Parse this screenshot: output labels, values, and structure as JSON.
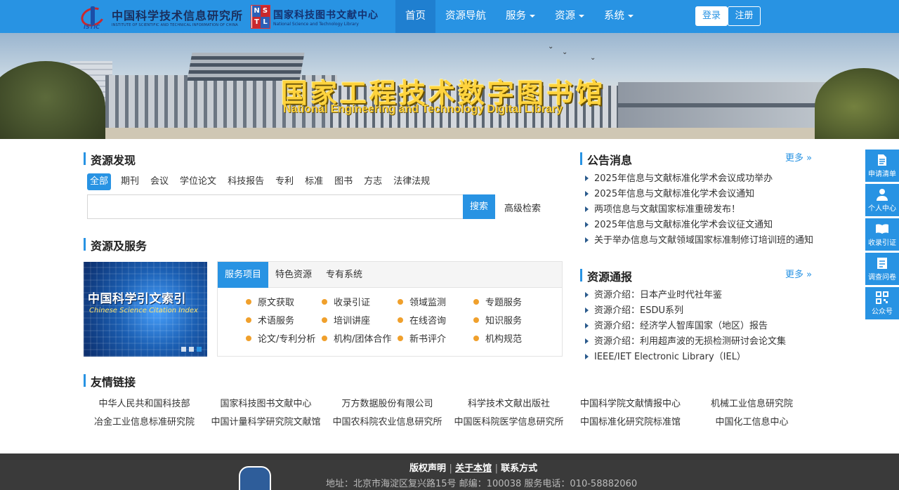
{
  "header": {
    "logo1": {
      "cn": "中国科学技术信息研究所",
      "en": "INSTITUTE OF SCIENTIFIC AND TECHNICAL INFORMATION OF CHINA",
      "mark": "ISTIC"
    },
    "logo2": {
      "cn": "国家科技图书文献中心",
      "en": "National Science and Technology Library",
      "mark": [
        "N",
        "S",
        "T",
        "L"
      ]
    },
    "menu": [
      "首页",
      "资源导航",
      "服务",
      "资源",
      "系统"
    ],
    "login": "登录",
    "register": "注册"
  },
  "banner": {
    "title": "国家工程技术数字图书馆",
    "subtitle": "National Engineering and Technology Digital Library"
  },
  "discovery": {
    "title": "资源发现",
    "tabs": [
      "全部",
      "期刊",
      "会议",
      "学位论文",
      "科技报告",
      "专利",
      "标准",
      "图书",
      "方志",
      "法律法规"
    ],
    "search_button": "搜索",
    "advanced": "高级检索",
    "search_value": ""
  },
  "services": {
    "title": "资源及服务",
    "carousel": {
      "cn": "中国科学引文索引",
      "en": "Chinese Science Citation Index"
    },
    "tabs": [
      "服务项目",
      "特色资源",
      "专有系统"
    ],
    "items": [
      "原文获取",
      "收录引证",
      "领域监测",
      "专题服务",
      "术语服务",
      "培训讲座",
      "在线咨询",
      "知识服务",
      "论文/专利分析",
      "机构/团体合作",
      "新书评介",
      "机构规范"
    ]
  },
  "friends": {
    "title": "友情链接",
    "items": [
      "中华人民共和国科技部",
      "国家科技图书文献中心",
      "万方数据股份有限公司",
      "科学技术文献出版社",
      "中国科学院文献情报中心",
      "机械工业信息研究院",
      "冶金工业信息标准研究院",
      "中国计量科学研究院文献馆",
      "中国农科院农业信息研究所",
      "中国医科院医学信息研究所",
      "中国标准化研究院标准馆",
      "中国化工信息中心"
    ]
  },
  "notices": {
    "title": "公告消息",
    "more": "更多 »",
    "items": [
      "2025年信息与文献标准化学术会议成功举办",
      "2025年信息与文献标准化学术会议通知",
      "两项信息与文献国家标准重磅发布！",
      "2025年信息与文献标准化学术会议征文通知",
      "关于举办信息与文献领域国家标准制修订培训班的通知"
    ]
  },
  "resources_news": {
    "title": "资源通报",
    "more": "更多 »",
    "items": [
      "资源介绍：日本产业时代社年鉴",
      "资源介绍：ESDU系列",
      "资源介绍：经济学人智库国家（地区）报告",
      "资源介绍：利用超声波的无损检测研讨会论文集",
      "IEEE/IET Electronic Library（IEL）"
    ]
  },
  "sidebar": [
    "申请清单",
    "个人中心",
    "收录引证",
    "调查问卷",
    "公众号"
  ],
  "footer": {
    "copyright": "版权声明",
    "about": "关于本馆",
    "contact": "联系方式",
    "address": "地址：北京市海淀区复兴路15号 邮编：100038 服务电话：010-58882060"
  }
}
